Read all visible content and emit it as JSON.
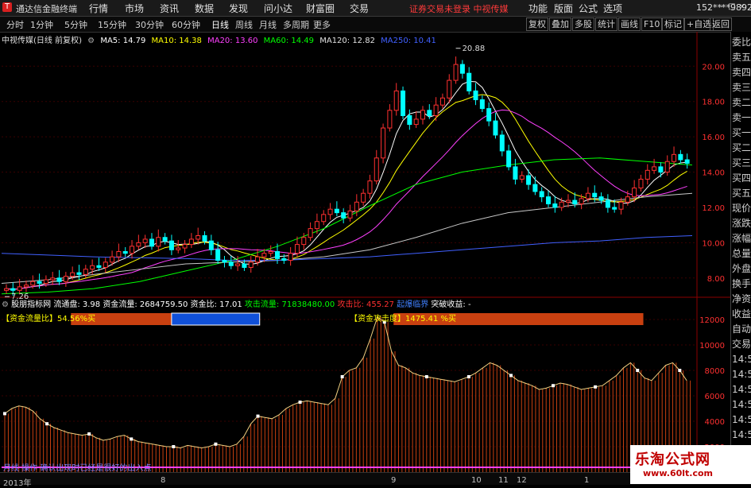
{
  "topbar": {
    "logo": "T",
    "app_title": "通达信金融终端",
    "menus": [
      "行情",
      "市场",
      "资讯",
      "数据",
      "发现",
      "问小达",
      "财富圈",
      "交易"
    ],
    "alert": "证券交易未登录  中视传媒",
    "right_menus": [
      "功能",
      "版面",
      "公式",
      "选项"
    ],
    "user": "152****9892",
    "win_controls": [
      "-",
      "□",
      "×"
    ]
  },
  "periodbar": {
    "periods": [
      "分时",
      "1分钟",
      "5分钟",
      "15分钟",
      "30分钟",
      "60分钟",
      "日线",
      "周线",
      "月线",
      "多周期",
      "更多"
    ],
    "active": "日线",
    "tools": [
      "复权",
      "叠加",
      "多股",
      "统计",
      "画线",
      "F10",
      "标记",
      "+自选",
      "返回"
    ]
  },
  "main_info": {
    "title": "中视传媒(日线 前复权)",
    "ma": [
      {
        "label": "MA5: 14.79",
        "color": "#ffffff"
      },
      {
        "label": "MA10: 14.38",
        "color": "#ffff00"
      },
      {
        "label": "MA20: 13.60",
        "color": "#ff40ff"
      },
      {
        "label": "MA60: 14.49",
        "color": "#00ff00"
      },
      {
        "label": "MA120: 12.82",
        "color": "#e0e0e0"
      },
      {
        "label": "MA250: 10.41",
        "color": "#4060ff"
      }
    ]
  },
  "right_tabs": [
    "委比",
    "卖五",
    "卖四",
    "卖三",
    "卖二",
    "卖一",
    "买一",
    "买二",
    "买三",
    "买四",
    "买五",
    "现价",
    "涨跌",
    "涨幅",
    "总量",
    "外盘",
    "换手",
    "净资",
    "收益",
    "自动",
    "交易",
    "14:5",
    "14:5",
    "14:5",
    "14:5",
    "14:5",
    "14:5",
    "14:5",
    "14:5",
    "14:5"
  ],
  "indicator": {
    "line": [
      {
        "label": "股朋指标网",
        "color": "#ffffff"
      },
      {
        "label": "流通盘: 3.98",
        "color": "#ffffff"
      },
      {
        "label": "资金流量: 2684759.50",
        "color": "#ffffff"
      },
      {
        "label": "资金比: 17.01",
        "color": "#ffffff"
      },
      {
        "label": "攻击流量: 71838480.00",
        "color": "#00ff00"
      },
      {
        "label": "攻击比: 455.27",
        "color": "#ff3030"
      },
      {
        "label": "起爆临界",
        "color": "#4080ff"
      },
      {
        "label": "突破收益: -",
        "color": "#ffffff"
      }
    ],
    "label1": "【资金流量比】54.56%买",
    "label2": "【资金攻击度】1475.41 %买",
    "bottom_label": "月线 操作 确认出现时已经是很好的出入点"
  },
  "colors": {
    "up": "#ff3030",
    "down": "#00ffff",
    "grid": "#8b0000"
  },
  "dates": [
    "2013年",
    "8",
    "9",
    "10",
    "11",
    "12",
    "1"
  ],
  "watermark": {
    "title": "乐淘公式网",
    "url": "www.60lt.com"
  },
  "chart_data": [
    {
      "type": "candlestick",
      "title": "中视传媒(日线 前复权)",
      "ylim": [
        7.0,
        21.5
      ],
      "y_ticks": [
        "20.00",
        "18.00",
        "16.00",
        "14.00",
        "12.00",
        "10.00",
        "8.00"
      ],
      "annotations": [
        {
          "label": "20.88",
          "value": 20.88
        },
        {
          "label": "7.26",
          "value": 7.26
        }
      ],
      "close": [
        7.4,
        7.3,
        7.5,
        7.6,
        7.8,
        7.7,
        7.9,
        8.0,
        7.8,
        8.1,
        8.3,
        8.2,
        8.5,
        8.7,
        8.6,
        8.9,
        9.2,
        9.5,
        9.4,
        9.8,
        10.0,
        10.2,
        9.8,
        10.3,
        10.1,
        9.6,
        9.7,
        9.9,
        10.2,
        10.4,
        10.1,
        9.6,
        9.0,
        8.9,
        8.7,
        8.8,
        8.6,
        8.9,
        9.2,
        9.4,
        9.5,
        9.1,
        9.0,
        9.4,
        9.9,
        10.3,
        10.8,
        11.2,
        11.6,
        11.9,
        11.7,
        11.4,
        11.8,
        12.3,
        12.8,
        13.5,
        14.8,
        16.5,
        17.5,
        18.6,
        17.2,
        16.7,
        17.0,
        17.5,
        17.2,
        17.8,
        18.2,
        19.2,
        20.1,
        19.6,
        18.6,
        18.1,
        17.6,
        16.9,
        16.1,
        15.2,
        14.3,
        13.6,
        13.8,
        13.3,
        12.9,
        12.6,
        12.2,
        12.0,
        12.3,
        12.4,
        12.2,
        12.5,
        12.8,
        12.6,
        12.4,
        12.0,
        11.9,
        12.3,
        12.6,
        13.1,
        13.6,
        14.1,
        14.3,
        14.0,
        14.6,
        15.0,
        14.7,
        14.5
      ],
      "ma": [
        {
          "name": "MA5",
          "color": "#ffffff"
        },
        {
          "name": "MA10",
          "color": "#ffff00"
        },
        {
          "name": "MA20",
          "color": "#ff40ff"
        },
        {
          "name": "MA60",
          "color": "#00ff00",
          "values": [
            7.1,
            7.2,
            7.4,
            7.8,
            8.4,
            9.0,
            9.8,
            10.8,
            12.1,
            13.3,
            14.0,
            14.4,
            14.7,
            14.8,
            14.6,
            14.4
          ]
        },
        {
          "name": "MA120",
          "color": "#c8c8c8",
          "values": [
            7.7,
            7.9,
            8.2,
            8.5,
            8.8,
            8.9,
            9.0,
            9.2,
            9.6,
            10.3,
            11.1,
            11.7,
            12.0,
            12.3,
            12.6,
            12.8
          ]
        },
        {
          "name": "MA250",
          "color": "#4060ff",
          "values": [
            9.4,
            9.3,
            9.2,
            9.15,
            9.1,
            9.0,
            9.0,
            9.1,
            9.2,
            9.4,
            9.6,
            9.8,
            10.0,
            10.1,
            10.3,
            10.4
          ]
        }
      ]
    },
    {
      "type": "bar",
      "title": "股朋指标网",
      "ylim": [
        0,
        13000
      ],
      "y_ticks": [
        "12000",
        "10000",
        "8000",
        "6000",
        "4000",
        "2000"
      ],
      "values": [
        4600,
        5000,
        5200,
        5100,
        4800,
        4200,
        3800,
        3500,
        3300,
        3100,
        3000,
        2900,
        3000,
        2700,
        2500,
        2600,
        2800,
        2900,
        2600,
        2400,
        2300,
        2200,
        2100,
        2000,
        2000,
        1900,
        2100,
        2000,
        1900,
        2000,
        2200,
        2100,
        2000,
        2200,
        2800,
        3800,
        4400,
        4300,
        4200,
        4500,
        5000,
        5300,
        5500,
        5600,
        5500,
        5400,
        5300,
        5800,
        7500,
        8000,
        8200,
        9000,
        10500,
        12200,
        11800,
        9500,
        8400,
        8200,
        7800,
        7600,
        7500,
        7400,
        7300,
        7200,
        7100,
        7300,
        7500,
        7800,
        8200,
        8600,
        8400,
        8000,
        7600,
        7200,
        7000,
        6800,
        6500,
        6600,
        6800,
        7000,
        6900,
        6700,
        6500,
        6600,
        6700,
        6800,
        7200,
        7600,
        8200,
        8600,
        8000,
        7400,
        7200,
        7800,
        8400,
        8600,
        8000,
        7200
      ],
      "red_bars": [
        {
          "from": 0.1,
          "to": 0.245
        },
        {
          "from": 0.565,
          "to": 0.925
        }
      ],
      "blue_bar": {
        "from": 0.245,
        "to": 0.372
      }
    }
  ]
}
